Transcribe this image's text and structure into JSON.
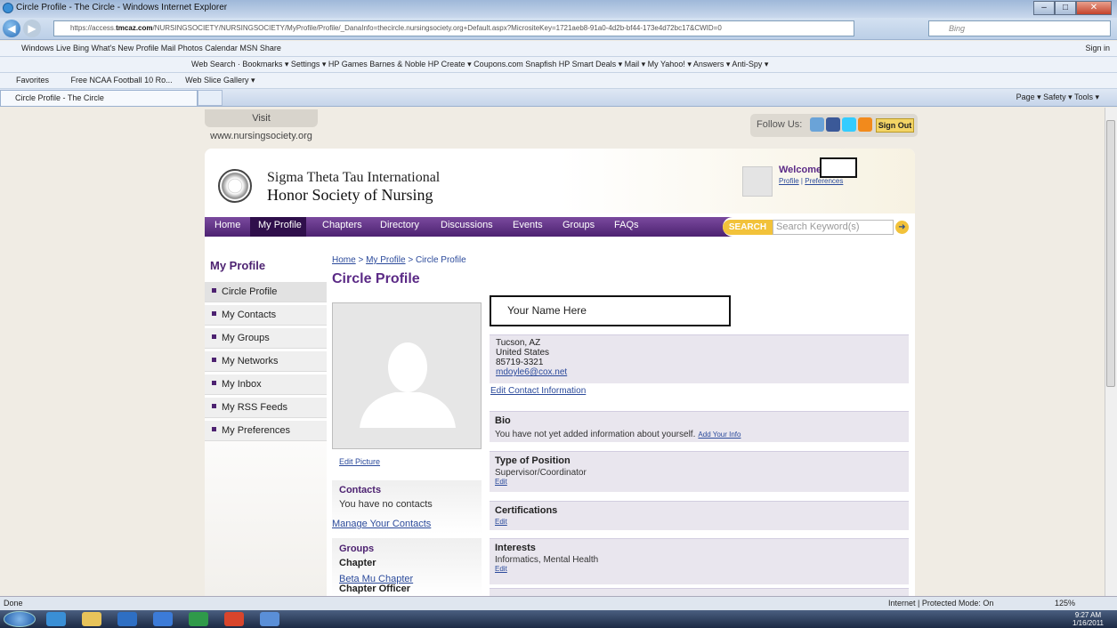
{
  "window": {
    "title": "Circle Profile - The Circle - Windows Internet Explorer",
    "min": "–",
    "max": "□",
    "close": "✕"
  },
  "address": {
    "prefix": "https://access.",
    "domain": "tmcaz.com",
    "path": "/NURSINGSOCIETY/NURSINGSOCIETY/MyProfile/Profile/_DanaInfo=thecircle.nursingsociety.org+Default.aspx?MicrositeKey=1721aeb8-91a0-4d2b-bf44-173e4d72bc17&CWID=0",
    "search_placeholder": "Bing"
  },
  "toolbar1": {
    "text": "Windows Live  Bing      What's New  Profile  Mail  Photos  Calendar  MSN  Share",
    "right": "Sign in"
  },
  "toolbar2": {
    "text": "Web Search ·  Bookmarks ▾  Settings ▾  HP Games  Barnes & Noble  HP Create ▾  Coupons.com  Snapfish  HP Smart Deals ▾  Mail ▾  My Yahoo! ▾  Answers ▾  Anti-Spy ▾"
  },
  "favorites": {
    "label": "Favorites",
    "item1": "Free NCAA Football 10 Ro...",
    "item2": "Web Slice Gallery ▾"
  },
  "tab": {
    "label": "Circle Profile - The Circle",
    "cmd": "Page ▾  Safety ▾  Tools ▾"
  },
  "site": {
    "visit": "Visit www.nursingsociety.org",
    "follow": "Follow Us:",
    "signout": "Sign Out",
    "org_line1": "Sigma Theta Tau International",
    "org_line2": "Honor Society of Nursing",
    "welcome": "Welcome",
    "profile_link": "Profile",
    "sep": "|",
    "preferences_link": "Preferences"
  },
  "nav": {
    "items": [
      "Home",
      "My Profile",
      "Chapters",
      "Directory",
      "Discussions",
      "Events",
      "Groups",
      "FAQs"
    ],
    "search_label": "SEARCH",
    "search_placeholder": "Search Keyword(s)",
    "go": "➜"
  },
  "sidebar": {
    "title": "My Profile",
    "items": [
      "Circle Profile",
      "My Contacts",
      "My Groups",
      "My Networks",
      "My Inbox",
      "My RSS Feeds",
      "My Preferences"
    ]
  },
  "main": {
    "breadcrumb": {
      "home": "Home",
      "sep": " > ",
      "profile": "My Profile",
      "current": "Circle Profile"
    },
    "title": "Circle Profile",
    "name": "Your Name Here",
    "city": "Tucson, AZ",
    "country": "United States",
    "zip": "85719-3321",
    "email": "mdoyle6@cox.net",
    "edit_contact": "Edit Contact Information",
    "edit_picture": "Edit Picture",
    "contacts_label": "Contacts",
    "contacts_text": "You have no contacts",
    "manage_contacts": "Manage Your Contacts",
    "groups_label": "Groups",
    "chapter_label": "Chapter",
    "chapter_link": "Beta Mu Chapter",
    "chapter_officer": "Chapter Officer",
    "bio_label": "Bio",
    "bio_text": "You have not yet added information about yourself.",
    "bio_link": "Add Your Info",
    "position_label": "Type of Position",
    "position_value": "Supervisor/Coordinator",
    "edit": "Edit",
    "cert_label": "Certifications",
    "interests_label": "Interests",
    "interests_value": "Informatics, Mental Health"
  },
  "status": {
    "left": "Done",
    "zone": "Internet | Protected Mode: On",
    "zoom": "125%"
  },
  "clock": {
    "time": "9:27 AM",
    "date": "1/16/2011"
  }
}
